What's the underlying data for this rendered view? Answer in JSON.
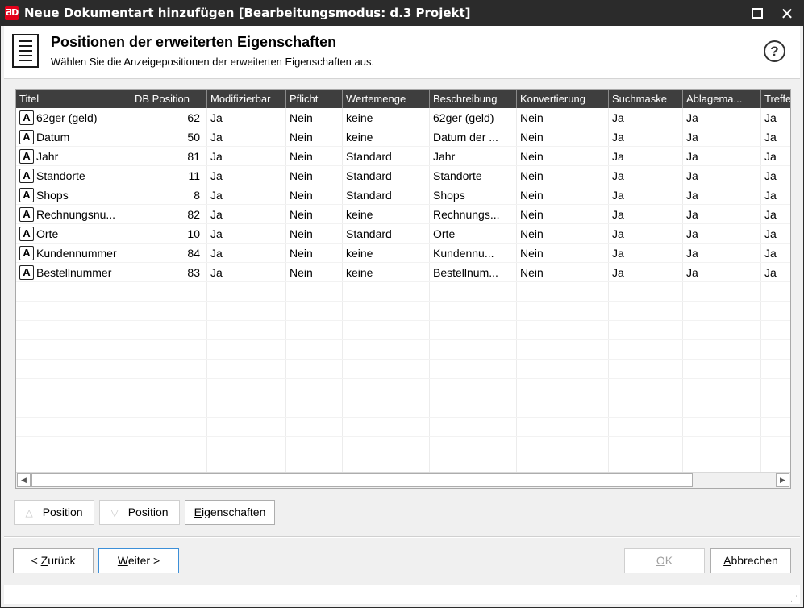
{
  "window": {
    "logo": "ƋD",
    "title": "Neue Dokumentart hinzufügen  [Bearbeitungsmodus: d.3 Projekt]",
    "maximize_icon": "maximize-icon",
    "close_symbol": "✕"
  },
  "header": {
    "title": "Positionen der erweiterten Eigenschaften",
    "subtitle": "Wählen Sie die Anzeigepositionen der erweiterten Eigenschaften aus.",
    "help_symbol": "?"
  },
  "grid": {
    "columns": [
      "Titel",
      "DB Position",
      "Modifizierbar",
      "Pflicht",
      "Wertemenge",
      "Beschreibung",
      "Konvertierung",
      "Suchmaske",
      "Ablagema...",
      "Treffe"
    ],
    "type_glyph": "A",
    "rows": [
      {
        "titel": "62ger (geld)",
        "db": "62",
        "mod": "Ja",
        "pflicht": "Nein",
        "werte": "keine",
        "beschr": "62ger (geld)",
        "konv": "Nein",
        "such": "Ja",
        "ablage": "Ja",
        "treffer": "Ja"
      },
      {
        "titel": "Datum",
        "db": "50",
        "mod": "Ja",
        "pflicht": "Nein",
        "werte": "keine",
        "beschr": "Datum der ...",
        "konv": "Nein",
        "such": "Ja",
        "ablage": "Ja",
        "treffer": "Ja"
      },
      {
        "titel": "Jahr",
        "db": "81",
        "mod": "Ja",
        "pflicht": "Nein",
        "werte": "Standard",
        "beschr": "Jahr",
        "konv": "Nein",
        "such": "Ja",
        "ablage": "Ja",
        "treffer": "Ja"
      },
      {
        "titel": "Standorte",
        "db": "11",
        "mod": "Ja",
        "pflicht": "Nein",
        "werte": "Standard",
        "beschr": "Standorte",
        "konv": "Nein",
        "such": "Ja",
        "ablage": "Ja",
        "treffer": "Ja"
      },
      {
        "titel": "Shops",
        "db": "8",
        "mod": "Ja",
        "pflicht": "Nein",
        "werte": "Standard",
        "beschr": "Shops",
        "konv": "Nein",
        "such": "Ja",
        "ablage": "Ja",
        "treffer": "Ja"
      },
      {
        "titel": "Rechnungsnu...",
        "db": "82",
        "mod": "Ja",
        "pflicht": "Nein",
        "werte": "keine",
        "beschr": "Rechnungs...",
        "konv": "Nein",
        "such": "Ja",
        "ablage": "Ja",
        "treffer": "Ja"
      },
      {
        "titel": "Orte",
        "db": "10",
        "mod": "Ja",
        "pflicht": "Nein",
        "werte": "Standard",
        "beschr": "Orte",
        "konv": "Nein",
        "such": "Ja",
        "ablage": "Ja",
        "treffer": "Ja"
      },
      {
        "titel": "Kundennummer",
        "db": "84",
        "mod": "Ja",
        "pflicht": "Nein",
        "werte": "keine",
        "beschr": "Kundennu...",
        "konv": "Nein",
        "such": "Ja",
        "ablage": "Ja",
        "treffer": "Ja"
      },
      {
        "titel": "Bestellnummer",
        "db": "83",
        "mod": "Ja",
        "pflicht": "Nein",
        "werte": "keine",
        "beschr": "Bestellnum...",
        "konv": "Nein",
        "such": "Ja",
        "ablage": "Ja",
        "treffer": "Ja"
      }
    ]
  },
  "scrollbar": {
    "left_arrow": "◀",
    "right_arrow": "▶"
  },
  "actions": {
    "up_triangle": "△",
    "down_triangle": "▽",
    "position_up": "Position",
    "position_down": "Position",
    "properties_mnemonic": "E",
    "properties_rest": "igenschaften"
  },
  "footer": {
    "back_prefix": "< ",
    "back_mnemonic": "Z",
    "back_rest": "urück",
    "next_mnemonic": "W",
    "next_rest": "eiter >",
    "ok_mnemonic": "O",
    "ok_rest": "K",
    "cancel_mnemonic": "A",
    "cancel_rest": "bbrechen",
    "grip": "⋰"
  },
  "colors": {
    "titlebar": "#2b2b2b",
    "logo": "#e2001a",
    "grid_header": "#3e3e3e",
    "primary_border": "#3c8fd8"
  }
}
